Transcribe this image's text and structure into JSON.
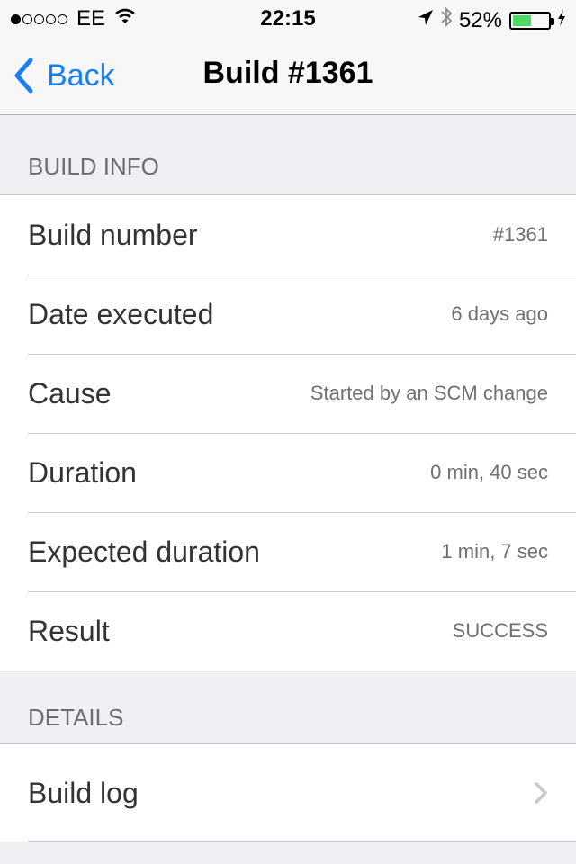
{
  "status_bar": {
    "carrier": "EE",
    "signal_dots_filled": 1,
    "signal_dots_total": 5,
    "time": "22:15",
    "battery_percent_label": "52%",
    "battery_level": 0.52,
    "icons": [
      "wifi-icon",
      "location-arrow-icon",
      "bluetooth-icon",
      "charging-bolt-icon"
    ]
  },
  "nav": {
    "back_label": "Back",
    "title": "Build #1361"
  },
  "sections": {
    "build_info": {
      "header": "BUILD INFO",
      "rows": [
        {
          "label": "Build number",
          "value": "#1361"
        },
        {
          "label": "Date executed",
          "value": "6 days ago"
        },
        {
          "label": "Cause",
          "value": "Started by an SCM change"
        },
        {
          "label": "Duration",
          "value": "0 min, 40 sec"
        },
        {
          "label": "Expected duration",
          "value": "1 min, 7 sec"
        },
        {
          "label": "Result",
          "value": "SUCCESS"
        }
      ]
    },
    "details": {
      "header": "DETAILS",
      "rows": [
        {
          "label": "Build log"
        }
      ]
    }
  },
  "colors": {
    "accent": "#157efb",
    "background": "#efeff4",
    "battery": "#4cd964"
  }
}
